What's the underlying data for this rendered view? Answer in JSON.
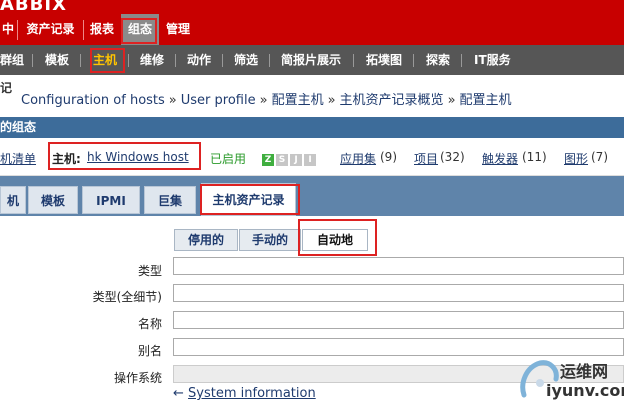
{
  "app": {
    "logo_text": "ABBIX"
  },
  "main_menu": {
    "items": [
      "中",
      "资产记录",
      "报表",
      "组态",
      "管理"
    ],
    "active_index": 3
  },
  "sub_menu": {
    "items": [
      "群组",
      "模板",
      "主机",
      "维修",
      "动作",
      "筛选",
      "简报片展示",
      "拓墣图",
      "探索",
      "IT服务"
    ],
    "active_index": 2
  },
  "history": {
    "label": "记",
    "crumbs": [
      "Configuration of hosts",
      "User profile",
      "配置主机",
      "主机资产记录概览",
      "配置主机"
    ],
    "separator": "»"
  },
  "section": {
    "title": "的组态"
  },
  "host_row": {
    "host_list_link": "机清单",
    "host_prefix": "主机:",
    "host_name": "hk Windows host",
    "status": "已启用",
    "availability": [
      "Z",
      "S",
      "J",
      "I"
    ],
    "applications": {
      "label": "应用集",
      "count": "(9)"
    },
    "items": {
      "label": "项目",
      "count": "(32)"
    },
    "triggers": {
      "label": "触发器",
      "count": "(11)"
    },
    "graphs": {
      "label": "图形",
      "count": "(7)"
    }
  },
  "tabs": {
    "items": [
      "机",
      "模板",
      "IPMI",
      "巨集",
      "主机资产记录"
    ],
    "active_index": 4
  },
  "inventory_mode": {
    "options": [
      "停用的",
      "手动的",
      "自动地"
    ],
    "selected": "自动地"
  },
  "fields": [
    {
      "label": "类型",
      "value": ""
    },
    {
      "label": "类型(全细节)",
      "value": ""
    },
    {
      "label": "名称",
      "value": ""
    },
    {
      "label": "别名",
      "value": ""
    },
    {
      "label": "操作系统",
      "value": ""
    }
  ],
  "system_info_link": "System information",
  "system_info_arrow": "←",
  "watermark": {
    "line1": "运维网",
    "line2": "iyunv.com"
  },
  "colors": {
    "brand_red": "#c80000",
    "submenu_bg": "#565656",
    "active_sub": "#ffc400",
    "section_blue": "#3d6c9a",
    "tab_bar": "#5f84aa",
    "highlight_box": "#dd2222",
    "ok_green": "#2a9a2a"
  }
}
